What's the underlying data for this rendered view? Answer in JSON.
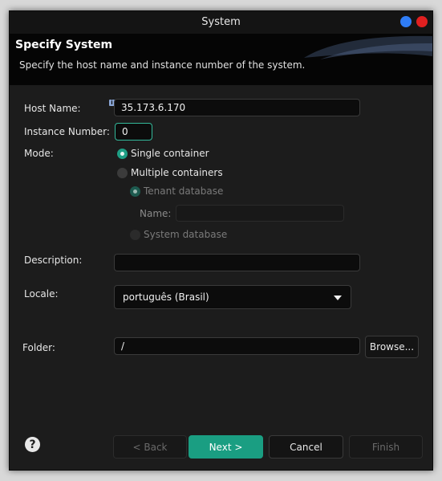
{
  "window": {
    "title": "System"
  },
  "header": {
    "title": "Specify System",
    "description": "Specify the host name and instance number of the system."
  },
  "form": {
    "host_name": {
      "label": "Host Name:",
      "value": "35.173.6.170"
    },
    "instance_number": {
      "label": "Instance Number:",
      "value": "0"
    },
    "mode": {
      "label": "Mode:",
      "single": "Single container",
      "multiple": "Multiple containers",
      "tenant": "Tenant database",
      "tenant_name_label": "Name:",
      "tenant_name_value": "",
      "system_db": "System database",
      "selected": "Single container"
    },
    "description": {
      "label": "Description:",
      "value": ""
    },
    "locale": {
      "label": "Locale:",
      "value": "português (Brasil)"
    },
    "folder": {
      "label": "Folder:",
      "value": "/",
      "browse": "Browse..."
    }
  },
  "footer": {
    "help": "?",
    "back": "< Back",
    "next": "Next >",
    "cancel": "Cancel",
    "finish": "Finish"
  },
  "colors": {
    "accent": "#1a9e82",
    "close": "#e02020",
    "minimize": "#2f7df6"
  }
}
